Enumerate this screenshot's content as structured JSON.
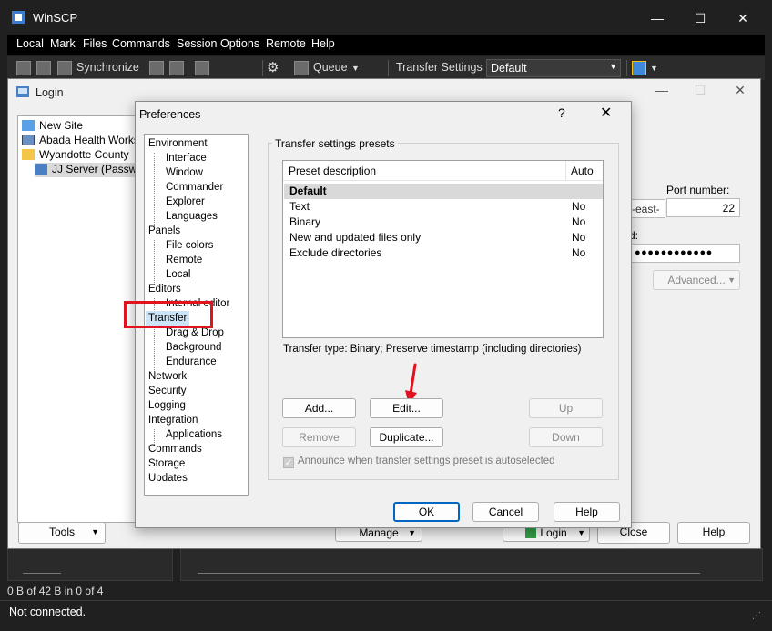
{
  "app": {
    "title": "WinSCP",
    "menu": [
      "Local",
      "Mark",
      "Files",
      "Commands",
      "Session",
      "Options",
      "Remote",
      "Help"
    ],
    "toolbar": {
      "synchronize": "Synchronize",
      "queue": "Queue",
      "transfer_settings_label": "Transfer Settings",
      "transfer_settings_value": "Default"
    },
    "status_transfer": "0 B of 42 B in 0 of 4",
    "status_connection": "Not connected."
  },
  "login": {
    "title": "Login",
    "sites": [
      {
        "label": "New Site",
        "icon": "new-site-icon"
      },
      {
        "label": "Abada Health Worksp",
        "icon": "site-icon"
      },
      {
        "label": "Wyandotte County",
        "icon": "folder-icon"
      },
      {
        "label": "JJ Server (Passwo",
        "icon": "computer-icon"
      }
    ],
    "host_fragment": "-east-",
    "port_label": "Port number:",
    "port_value": "22",
    "password_label_fragment": "d:",
    "password_mask": "●●●●●●●●●●●●",
    "advanced_label": "Advanced...",
    "tools_label": "Tools",
    "manage_label": "Manage",
    "login_button": "Login",
    "close_button": "Close",
    "help_button": "Help"
  },
  "prefs": {
    "title": "Preferences",
    "help_glyph": "?",
    "close_glyph": "✕",
    "nav": [
      {
        "label": "Environment",
        "level": 0
      },
      {
        "label": "Interface",
        "level": 1
      },
      {
        "label": "Window",
        "level": 1
      },
      {
        "label": "Commander",
        "level": 1
      },
      {
        "label": "Explorer",
        "level": 1
      },
      {
        "label": "Languages",
        "level": 1
      },
      {
        "label": "Panels",
        "level": 0
      },
      {
        "label": "File colors",
        "level": 1
      },
      {
        "label": "Remote",
        "level": 1
      },
      {
        "label": "Local",
        "level": 1
      },
      {
        "label": "Editors",
        "level": 0
      },
      {
        "label": "Internal editor",
        "level": 1
      },
      {
        "label": "Transfer",
        "level": 0,
        "selected": true
      },
      {
        "label": "Drag & Drop",
        "level": 1
      },
      {
        "label": "Background",
        "level": 1
      },
      {
        "label": "Endurance",
        "level": 1
      },
      {
        "label": "Network",
        "level": 0
      },
      {
        "label": "Security",
        "level": 0
      },
      {
        "label": "Logging",
        "level": 0
      },
      {
        "label": "Integration",
        "level": 0
      },
      {
        "label": "Applications",
        "level": 1
      },
      {
        "label": "Commands",
        "level": 0
      },
      {
        "label": "Storage",
        "level": 0
      },
      {
        "label": "Updates",
        "level": 0
      }
    ],
    "group_title": "Transfer settings presets",
    "columns": [
      "Preset description",
      "Auto"
    ],
    "presets": [
      {
        "description": "Default",
        "auto": "",
        "selected": true
      },
      {
        "description": "Text",
        "auto": "No"
      },
      {
        "description": "Binary",
        "auto": "No"
      },
      {
        "description": "New and updated files only",
        "auto": "No"
      },
      {
        "description": "Exclude directories",
        "auto": "No"
      }
    ],
    "transfer_type": "Transfer type: Binary; Preserve timestamp (including directories)",
    "buttons": {
      "add": "Add...",
      "edit": "Edit...",
      "up": "Up",
      "remove": "Remove",
      "duplicate": "Duplicate...",
      "down": "Down"
    },
    "announce_label": "Announce when transfer settings preset is autoselected",
    "ok": "OK",
    "cancel": "Cancel",
    "help": "Help"
  },
  "annotation_colors": {
    "highlight": "#e0141e",
    "arrow": "#e0141e"
  }
}
